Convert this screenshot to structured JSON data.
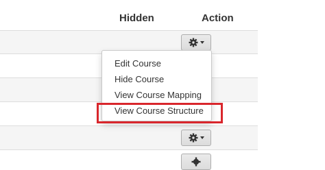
{
  "table": {
    "columns": {
      "hidden": "Hidden",
      "action": "Action"
    }
  },
  "dropdown": {
    "items": [
      {
        "label": "Edit Course"
      },
      {
        "label": "Hide Course"
      },
      {
        "label": "View Course Mapping"
      },
      {
        "label": "View Course Structure"
      }
    ],
    "highlighted_item": "View Course Structure"
  },
  "icons": {
    "action_button": "gear-icon",
    "caret": "chevron-down-icon"
  },
  "colors": {
    "highlight_border": "#d9262c",
    "stripe": "#f5f5f5"
  }
}
